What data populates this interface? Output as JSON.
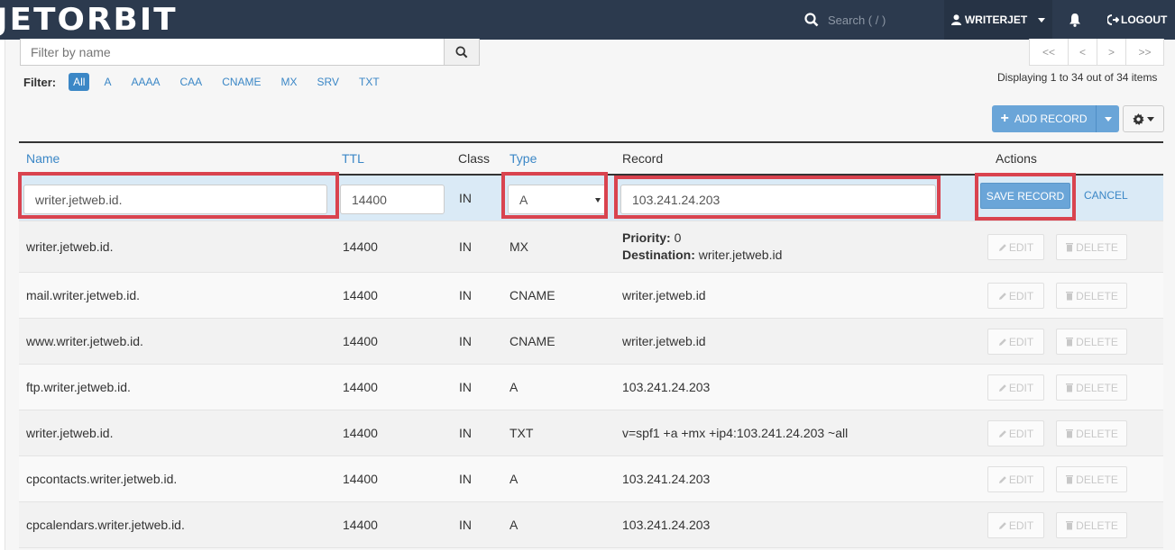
{
  "brand": "JETORBIT",
  "nav": {
    "search_placeholder": "Search ( / )",
    "user_label": "WRITERJET",
    "logout_label": "LOGOUT"
  },
  "toolbar": {
    "filter_placeholder": "Filter by name",
    "filter_label": "Filter:",
    "chips": [
      "All",
      "A",
      "AAAA",
      "CAA",
      "CNAME",
      "MX",
      "SRV",
      "TXT"
    ],
    "active_chip": "All",
    "pager": [
      "<<",
      "<",
      ">",
      ">>"
    ],
    "displaying": "Displaying 1 to 34 out of 34 items",
    "add_record_label": "ADD RECORD"
  },
  "table": {
    "headers": {
      "name": "Name",
      "ttl": "TTL",
      "class": "Class",
      "type": "Type",
      "record": "Record",
      "actions": "Actions"
    },
    "edit_row": {
      "name": "writer.jetweb.id.",
      "ttl": "14400",
      "class": "IN",
      "type": "A",
      "record": "103.241.24.203",
      "save_label": "SAVE RECORD",
      "cancel_label": "CANCEL"
    },
    "edit_label": "EDIT",
    "delete_label": "DELETE",
    "priority_label": "Priority:",
    "destination_label": "Destination:",
    "rows": [
      {
        "name": "writer.jetweb.id.",
        "ttl": "14400",
        "class": "IN",
        "type": "MX",
        "priority": "0",
        "destination": "writer.jetweb.id"
      },
      {
        "name": "mail.writer.jetweb.id.",
        "ttl": "14400",
        "class": "IN",
        "type": "CNAME",
        "record": "writer.jetweb.id"
      },
      {
        "name": "www.writer.jetweb.id.",
        "ttl": "14400",
        "class": "IN",
        "type": "CNAME",
        "record": "writer.jetweb.id"
      },
      {
        "name": "ftp.writer.jetweb.id.",
        "ttl": "14400",
        "class": "IN",
        "type": "A",
        "record": "103.241.24.203"
      },
      {
        "name": "writer.jetweb.id.",
        "ttl": "14400",
        "class": "IN",
        "type": "TXT",
        "record": "v=spf1 +a +mx +ip4:103.241.24.203 ~all"
      },
      {
        "name": "cpcontacts.writer.jetweb.id.",
        "ttl": "14400",
        "class": "IN",
        "type": "A",
        "record": "103.241.24.203"
      },
      {
        "name": "cpcalendars.writer.jetweb.id.",
        "ttl": "14400",
        "class": "IN",
        "type": "A",
        "record": "103.241.24.203"
      }
    ]
  },
  "colors": {
    "topbar": "#2c3a4e",
    "accent": "#3b87c6",
    "highlight": "#d9434f",
    "edit_row": "#daeaf6"
  }
}
